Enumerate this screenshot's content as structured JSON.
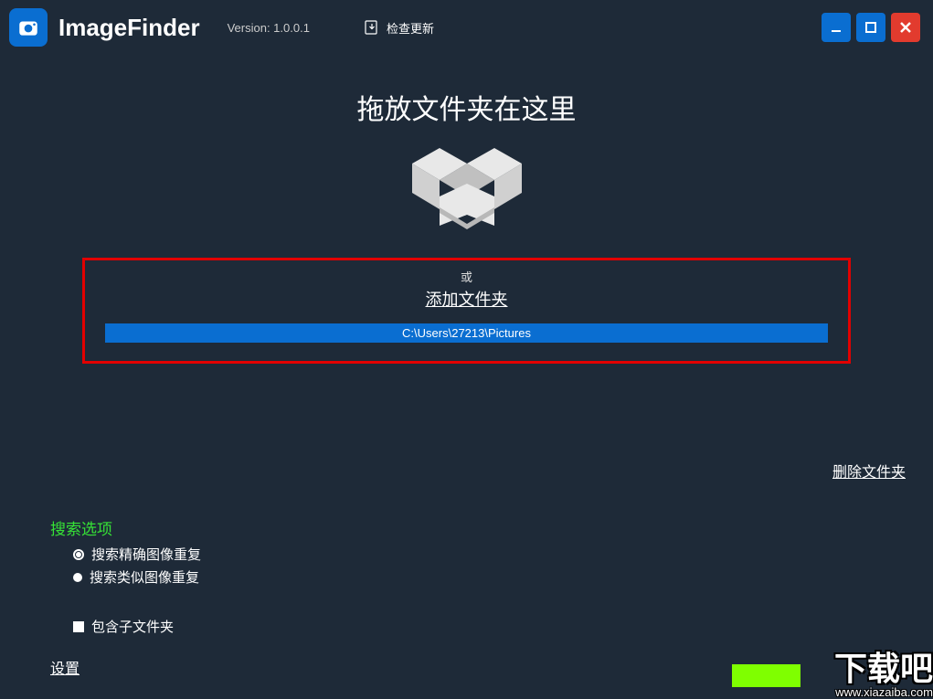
{
  "app": {
    "title": "ImageFinder",
    "version_label": "Version: 1.0.0.1",
    "check_update": "检查更新"
  },
  "drop": {
    "title": "拖放文件夹在这里",
    "or": "或",
    "add_folder": "添加文件夹",
    "path": "C:\\Users\\27213\\Pictures"
  },
  "actions": {
    "delete_folder": "删除文件夹"
  },
  "search": {
    "title": "搜索选项",
    "exact": "搜索精确图像重复",
    "similar": "搜索类似图像重复",
    "include_subfolders": "包含子文件夹"
  },
  "settings": "设置",
  "watermark": {
    "main": "下载吧",
    "url": "www.xiazaiba.com"
  }
}
